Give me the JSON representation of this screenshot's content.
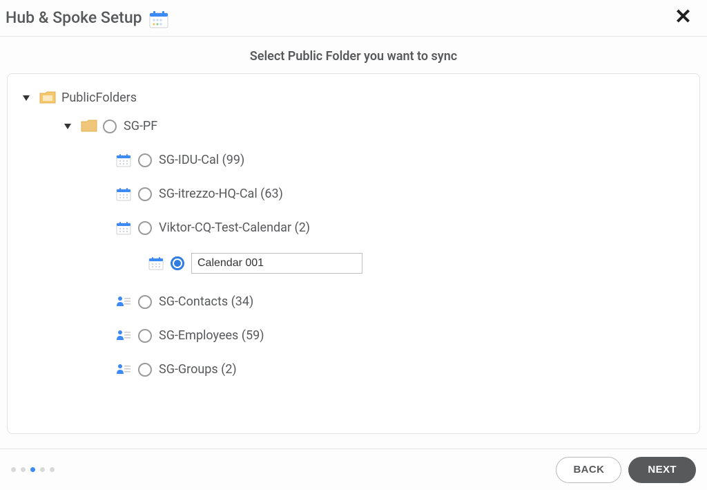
{
  "header": {
    "title": "Hub & Spoke Setup"
  },
  "subtitle": "Select Public Folder you want to sync",
  "tree": {
    "root_label": "PublicFolders",
    "group_label": "SG-PF",
    "items": [
      {
        "label": "SG-IDU-Cal (99)"
      },
      {
        "label": "SG-itrezzo-HQ-Cal (63)"
      },
      {
        "label": "Viktor-CQ-Test-Calendar (2)"
      }
    ],
    "selected_input_value": "Calendar 001",
    "contacts": [
      {
        "label": "SG-Contacts (34)"
      },
      {
        "label": "SG-Employees (59)"
      },
      {
        "label": "SG-Groups (2)"
      }
    ]
  },
  "footer": {
    "back_label": "BACK",
    "next_label": "NEXT",
    "active_step_index": 2,
    "total_steps": 5
  }
}
